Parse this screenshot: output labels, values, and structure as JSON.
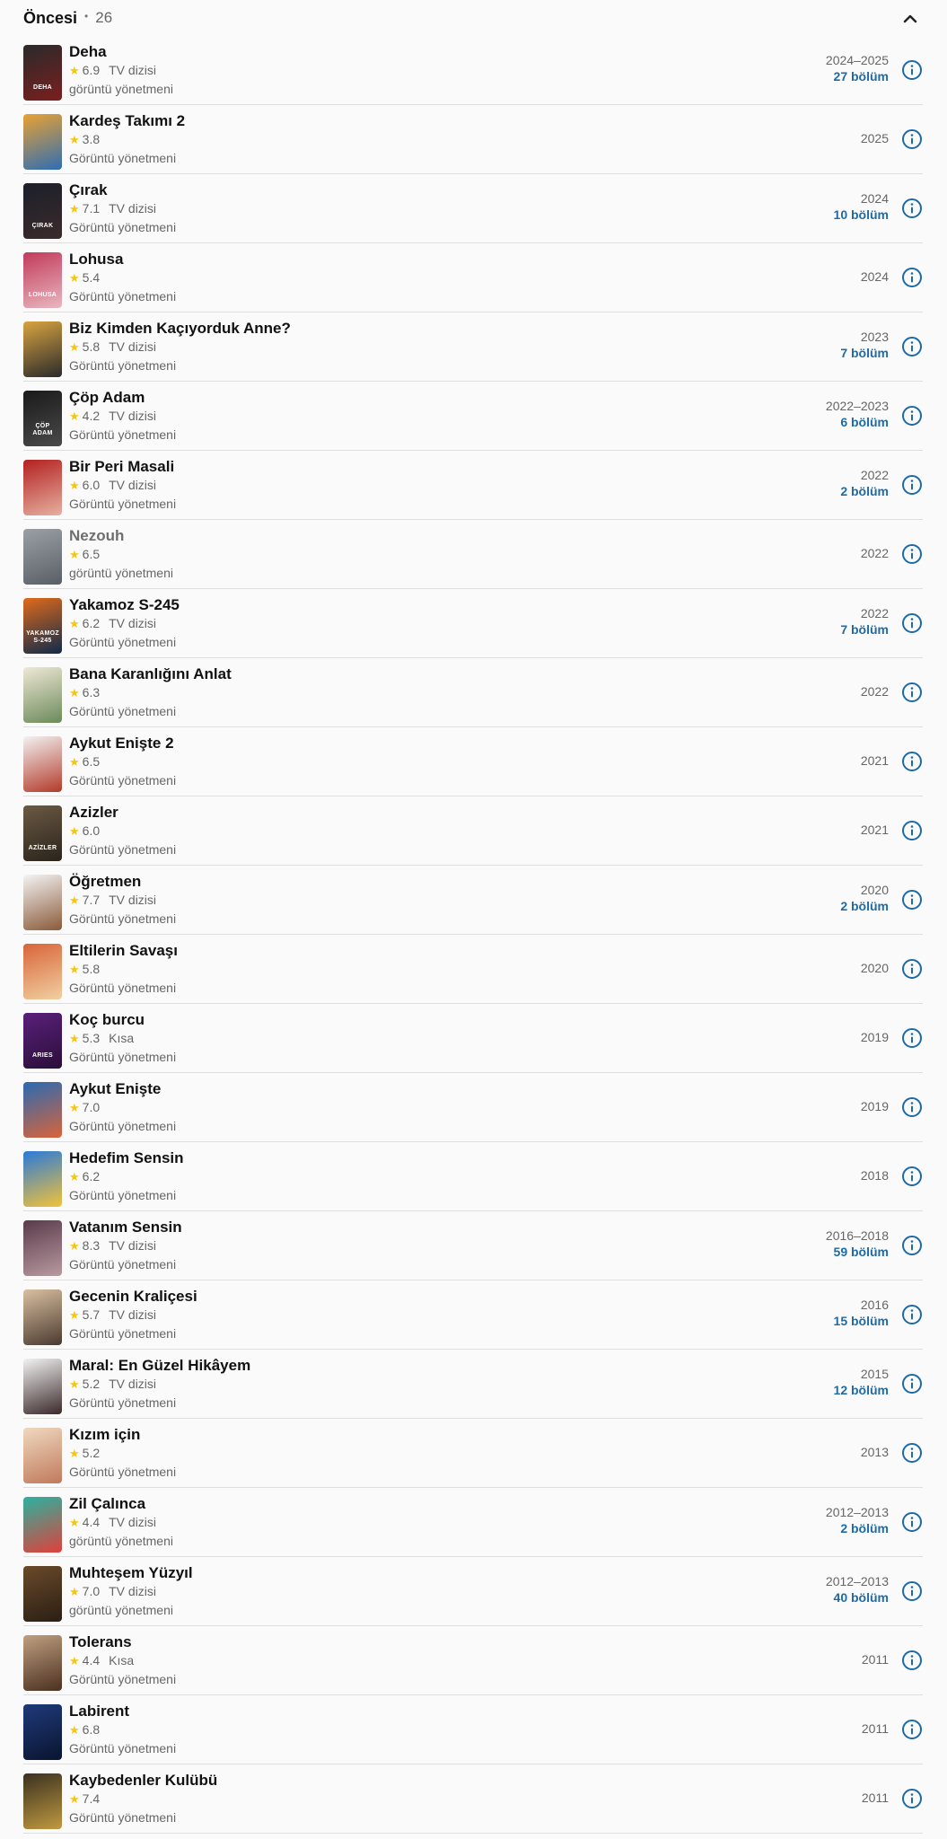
{
  "header": {
    "title": "Öncesi",
    "count": "26"
  },
  "colors": {
    "accent": "#1e6aa4",
    "star": "#f5c518",
    "text": "#1f1f1f",
    "muted": "#666666"
  },
  "items": [
    {
      "title": "Deha",
      "rating": "6.9",
      "kind": "TV dizisi",
      "role": "görüntü yönetmeni",
      "years": "2024–2025",
      "episodes": "27 bölüm",
      "poster_text": "DEHA",
      "poster_colors": [
        "#2a2a2a",
        "#7a1f1f"
      ],
      "dim": false
    },
    {
      "title": "Kardeş Takımı 2",
      "rating": "3.8",
      "kind": "",
      "role": "Görüntü yönetmeni",
      "years": "2025",
      "episodes": "",
      "poster_text": "",
      "poster_colors": [
        "#e9a233",
        "#2f6db3"
      ],
      "dim": false
    },
    {
      "title": "Çırak",
      "rating": "7.1",
      "kind": "TV dizisi",
      "role": "Görüntü yönetmeni",
      "years": "2024",
      "episodes": "10 bölüm",
      "poster_text": "ÇIRAK",
      "poster_colors": [
        "#1b1f2a",
        "#3b2b2b"
      ],
      "dim": false
    },
    {
      "title": "Lohusa",
      "rating": "5.4",
      "kind": "",
      "role": "Görüntü yönetmeni",
      "years": "2024",
      "episodes": "",
      "poster_text": "LOHUSA",
      "poster_colors": [
        "#c23a5a",
        "#e8b7c0"
      ],
      "dim": false
    },
    {
      "title": "Biz Kimden Kaçıyorduk Anne?",
      "rating": "5.8",
      "kind": "TV dizisi",
      "role": "Görüntü yönetmeni",
      "years": "2023",
      "episodes": "7 bölüm",
      "poster_text": "",
      "poster_colors": [
        "#d9a441",
        "#2a2a2a"
      ],
      "dim": false
    },
    {
      "title": "Çöp Adam",
      "rating": "4.2",
      "kind": "TV dizisi",
      "role": "Görüntü yönetmeni",
      "years": "2022–2023",
      "episodes": "6 bölüm",
      "poster_text": "ÇÖP ADAM",
      "poster_colors": [
        "#1a1a1a",
        "#4a4a4a"
      ],
      "dim": false
    },
    {
      "title": "Bir Peri Masali",
      "rating": "6.0",
      "kind": "TV dizisi",
      "role": "Görüntü yönetmeni",
      "years": "2022",
      "episodes": "2 bölüm",
      "poster_text": "",
      "poster_colors": [
        "#b32020",
        "#e6b0a0"
      ],
      "dim": false
    },
    {
      "title": "Nezouh",
      "rating": "6.5",
      "kind": "",
      "role": "görüntü yönetmeni",
      "years": "2022",
      "episodes": "",
      "poster_text": "",
      "poster_colors": [
        "#9aa0a6",
        "#5a5f66"
      ],
      "dim": true
    },
    {
      "title": "Yakamoz S-245",
      "rating": "6.2",
      "kind": "TV dizisi",
      "role": "Görüntü yönetmeni",
      "years": "2022",
      "episodes": "7 bölüm",
      "poster_text": "YAKAMOZ S-245",
      "poster_colors": [
        "#e06a1a",
        "#0f2a4a"
      ],
      "dim": false
    },
    {
      "title": "Bana Karanlığını Anlat",
      "rating": "6.3",
      "kind": "",
      "role": "Görüntü yönetmeni",
      "years": "2022",
      "episodes": "",
      "poster_text": "",
      "poster_colors": [
        "#efe8d6",
        "#6b8a5a"
      ],
      "dim": false
    },
    {
      "title": "Aykut Enişte 2",
      "rating": "6.5",
      "kind": "",
      "role": "Görüntü yönetmeni",
      "years": "2021",
      "episodes": "",
      "poster_text": "",
      "poster_colors": [
        "#f2f2f2",
        "#b33a2a"
      ],
      "dim": false
    },
    {
      "title": "Azizler",
      "rating": "6.0",
      "kind": "",
      "role": "Görüntü yönetmeni",
      "years": "2021",
      "episodes": "",
      "poster_text": "AZİZLER",
      "poster_colors": [
        "#6b5a44",
        "#2a241c"
      ],
      "dim": false
    },
    {
      "title": "Öğretmen",
      "rating": "7.7",
      "kind": "TV dizisi",
      "role": "Görüntü yönetmeni",
      "years": "2020",
      "episodes": "2 bölüm",
      "poster_text": "",
      "poster_colors": [
        "#f4f4f4",
        "#8a5a3a"
      ],
      "dim": false
    },
    {
      "title": "Eltilerin Savaşı",
      "rating": "5.8",
      "kind": "",
      "role": "Görüntü yönetmeni",
      "years": "2020",
      "episodes": "",
      "poster_text": "",
      "poster_colors": [
        "#d9643a",
        "#f0d0a0"
      ],
      "dim": false
    },
    {
      "title": "Koç burcu",
      "rating": "5.3",
      "kind": "Kısa",
      "role": "Görüntü yönetmeni",
      "years": "2019",
      "episodes": "",
      "poster_text": "ARIES",
      "poster_colors": [
        "#5a1f7a",
        "#2a0f3a"
      ],
      "dim": false
    },
    {
      "title": "Aykut Enişte",
      "rating": "7.0",
      "kind": "",
      "role": "Görüntü yönetmeni",
      "years": "2019",
      "episodes": "",
      "poster_text": "",
      "poster_colors": [
        "#2a6ab3",
        "#d9643a"
      ],
      "dim": false
    },
    {
      "title": "Hedefim Sensin",
      "rating": "6.2",
      "kind": "",
      "role": "Görüntü yönetmeni",
      "years": "2018",
      "episodes": "",
      "poster_text": "",
      "poster_colors": [
        "#2a7ad9",
        "#f2c23a"
      ],
      "dim": false
    },
    {
      "title": "Vatanım Sensin",
      "rating": "8.3",
      "kind": "TV dizisi",
      "role": "Görüntü yönetmeni",
      "years": "2016–2018",
      "episodes": "59 bölüm",
      "poster_text": "",
      "poster_colors": [
        "#5a3a4a",
        "#b89aa0"
      ],
      "dim": false
    },
    {
      "title": "Gecenin Kraliçesi",
      "rating": "5.7",
      "kind": "TV dizisi",
      "role": "Görüntü yönetmeni",
      "years": "2016",
      "episodes": "15 bölüm",
      "poster_text": "",
      "poster_colors": [
        "#d9c0a0",
        "#4a3a30"
      ],
      "dim": false
    },
    {
      "title": "Maral: En Güzel Hikâyem",
      "rating": "5.2",
      "kind": "TV dizisi",
      "role": "Görüntü yönetmeni",
      "years": "2015",
      "episodes": "12 bölüm",
      "poster_text": "",
      "poster_colors": [
        "#f2f2f2",
        "#3a2a2a"
      ],
      "dim": false
    },
    {
      "title": "Kızım için",
      "rating": "5.2",
      "kind": "",
      "role": "Görüntü yönetmeni",
      "years": "2013",
      "episodes": "",
      "poster_text": "",
      "poster_colors": [
        "#f0d8c0",
        "#c07a5a"
      ],
      "dim": false
    },
    {
      "title": "Zil Çalınca",
      "rating": "4.4",
      "kind": "TV dizisi",
      "role": "görüntü yönetmeni",
      "years": "2012–2013",
      "episodes": "2 bölüm",
      "poster_text": "",
      "poster_colors": [
        "#2ab3a0",
        "#e0403a"
      ],
      "dim": false
    },
    {
      "title": "Muhteşem Yüzyıl",
      "rating": "7.0",
      "kind": "TV dizisi",
      "role": "görüntü yönetmeni",
      "years": "2012–2013",
      "episodes": "40 bölüm",
      "poster_text": "",
      "poster_colors": [
        "#6a4a2a",
        "#2a1f14"
      ],
      "dim": false
    },
    {
      "title": "Tolerans",
      "rating": "4.4",
      "kind": "Kısa",
      "role": "Görüntü yönetmeni",
      "years": "2011",
      "episodes": "",
      "poster_text": "",
      "poster_colors": [
        "#c0a080",
        "#4a3020"
      ],
      "dim": false
    },
    {
      "title": "Labirent",
      "rating": "6.8",
      "kind": "",
      "role": "Görüntü yönetmeni",
      "years": "2011",
      "episodes": "",
      "poster_text": "",
      "poster_colors": [
        "#1f3a7a",
        "#0a1430"
      ],
      "dim": false
    },
    {
      "title": "Kaybedenler Kulübü",
      "rating": "7.4",
      "kind": "",
      "role": "Görüntü yönetmeni",
      "years": "2011",
      "episodes": "",
      "poster_text": "",
      "poster_colors": [
        "#3a3020",
        "#c09a40"
      ],
      "dim": false
    }
  ]
}
